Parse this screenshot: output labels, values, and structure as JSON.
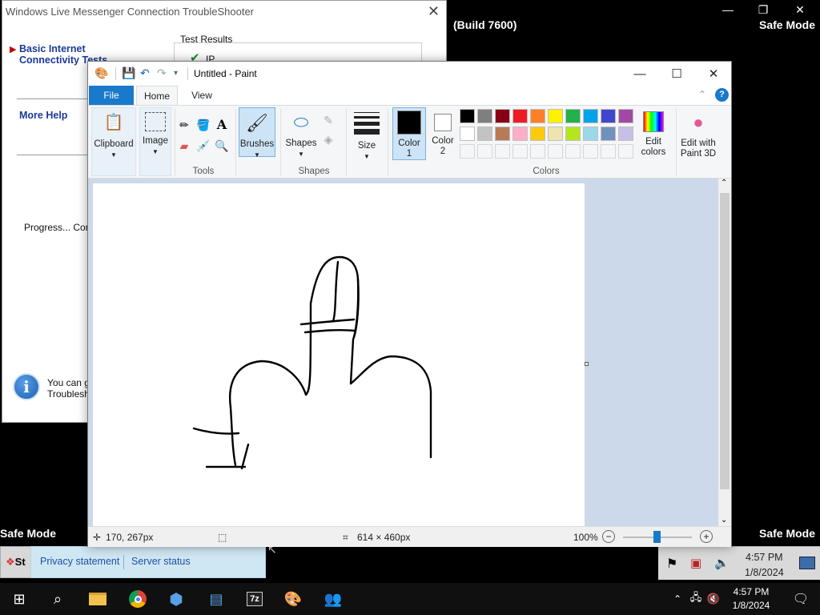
{
  "desktop": {
    "safe_mode_left": "Safe Mode",
    "safe_mode_right": "Safe Mode",
    "safe_mode_top_right": "Safe Mode",
    "build": "(Build 7600)"
  },
  "troubleshooter": {
    "title": "Windows Live Messenger Connection TroubleShooter",
    "nav_active": "Basic Internet Connectivity Tests",
    "more_help": "More Help",
    "test_results": "Test Results",
    "test_ip": "IP",
    "progress": "Progress... Comp",
    "info_line1": "You can g",
    "info_line2": "Troublesho",
    "privacy": "Privacy statement",
    "server_status": "Server status",
    "start_label": "St"
  },
  "legacy_tray": {
    "time": "4:57 PM",
    "date": "1/8/2024"
  },
  "paint": {
    "title": "Untitled - Paint",
    "tabs": [
      "File",
      "Home",
      "View"
    ],
    "ribbon": {
      "clipboard": "Clipboard",
      "image": "Image",
      "tools": "Tools",
      "brushes": "Brushes",
      "shapes_btn": "Shapes",
      "shapes_group": "Shapes",
      "size": "Size",
      "color1_a": "Color",
      "color1_b": "1",
      "color2_a": "Color",
      "color2_b": "2",
      "colors_group": "Colors",
      "edit_colors_a": "Edit",
      "edit_colors_b": "colors",
      "paint3d_a": "Edit with",
      "paint3d_b": "Paint 3D"
    },
    "palette_row1": [
      "#000000",
      "#7f7f7f",
      "#880015",
      "#ed1c24",
      "#ff7f27",
      "#fff200",
      "#22b14c",
      "#00a2e8",
      "#3f48cc",
      "#a349a4"
    ],
    "palette_row2": [
      "#ffffff",
      "#c3c3c3",
      "#b97a57",
      "#ffaec9",
      "#ffc90e",
      "#efe4b0",
      "#b5e61d",
      "#99d9ea",
      "#7092be",
      "#c8bfe7"
    ],
    "color1": "#000000",
    "color2": "#ffffff",
    "status": {
      "cursor": "170, 267px",
      "size": "614 × 460px",
      "zoom": "100%"
    }
  },
  "taskbar": {
    "time": "4:57 PM",
    "date": "1/8/2024"
  }
}
